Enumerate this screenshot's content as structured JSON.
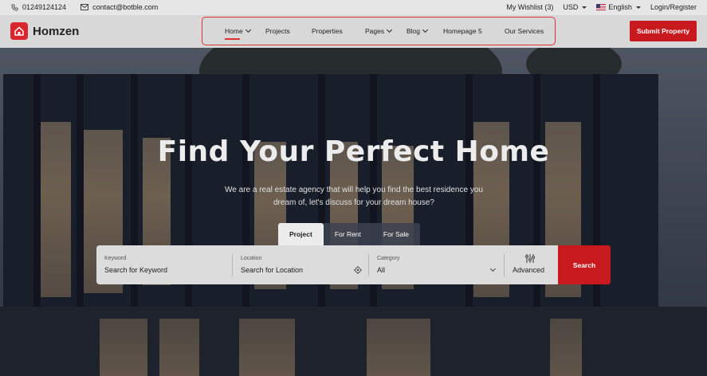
{
  "topbar": {
    "phone": "01249124124",
    "email": "contact@botble.com",
    "wishlist": "My Wishlist (3)",
    "currency": "USD",
    "language": "English",
    "auth": "Login/Register"
  },
  "header": {
    "logo": "Homzen",
    "nav": [
      {
        "label": "Home",
        "dropdown": true,
        "active": true
      },
      {
        "label": "Projects",
        "dropdown": false
      },
      {
        "label": "Properties",
        "dropdown": false
      },
      {
        "label": "Pages",
        "dropdown": true
      },
      {
        "label": "Blog",
        "dropdown": true
      },
      {
        "label": "Homepage 5",
        "dropdown": false
      },
      {
        "label": "Our Services",
        "dropdown": false
      }
    ],
    "submit": "Submit Property"
  },
  "hero": {
    "title": "Find Your Perfect Home",
    "subtitle": "We are a real estate agency that will help you find the best residence you dream of, let's discuss for your dream house?"
  },
  "search": {
    "tabs": [
      "Project",
      "For Rent",
      "For Sale"
    ],
    "active_tab": "Project",
    "keyword": {
      "label": "Keyword",
      "placeholder": "Search for Keyword"
    },
    "location": {
      "label": "Location",
      "placeholder": "Search for Location"
    },
    "category": {
      "label": "Category",
      "value": "All"
    },
    "advanced": "Advanced",
    "button": "Search"
  },
  "colors": {
    "accent": "#c8191f",
    "nav_border": "#dd3333"
  },
  "icons": [
    "phone-icon",
    "mail-icon",
    "house-logo-icon",
    "chevron-down-icon",
    "location-target-icon",
    "sliders-icon"
  ]
}
